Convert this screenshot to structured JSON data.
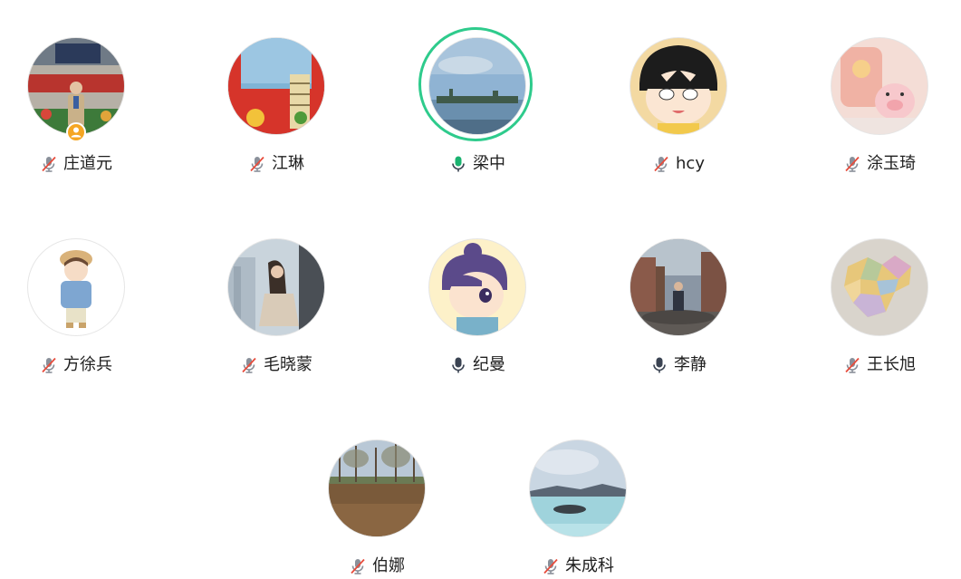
{
  "colors": {
    "speaking_ring": "#2ecb8c",
    "host_badge": "#f5a623",
    "mic_active": "#1ab270",
    "mic_on": "#3a4352",
    "mic_muted_slash": "#e74c3c",
    "mic_muted_body": "#8a909a"
  },
  "participants": [
    {
      "name": "庄道元",
      "mic": "muted",
      "host": true,
      "avatar": "photo-person-stage"
    },
    {
      "name": "江琳",
      "mic": "muted",
      "avatar": "photo-building-red"
    },
    {
      "name": "梁中",
      "mic": "speaking",
      "avatar": "photo-lake-sky"
    },
    {
      "name": "hcy",
      "mic": "muted",
      "avatar": "cartoon-girl-bob"
    },
    {
      "name": "涂玉琦",
      "mic": "muted",
      "avatar": "photo-pig-toy"
    },
    {
      "name": "方徐兵",
      "mic": "muted",
      "avatar": "cartoon-boy-hat"
    },
    {
      "name": "毛晓蒙",
      "mic": "muted",
      "avatar": "photo-woman-window"
    },
    {
      "name": "纪曼",
      "mic": "on",
      "avatar": "cartoon-girl-bun"
    },
    {
      "name": "李静",
      "mic": "on",
      "avatar": "photo-person-plaza"
    },
    {
      "name": "王长旭",
      "mic": "muted",
      "avatar": "photo-map"
    },
    {
      "name": "伯娜",
      "mic": "muted",
      "avatar": "photo-field-trees"
    },
    {
      "name": "朱成科",
      "mic": "muted",
      "avatar": "photo-lagoon"
    }
  ]
}
